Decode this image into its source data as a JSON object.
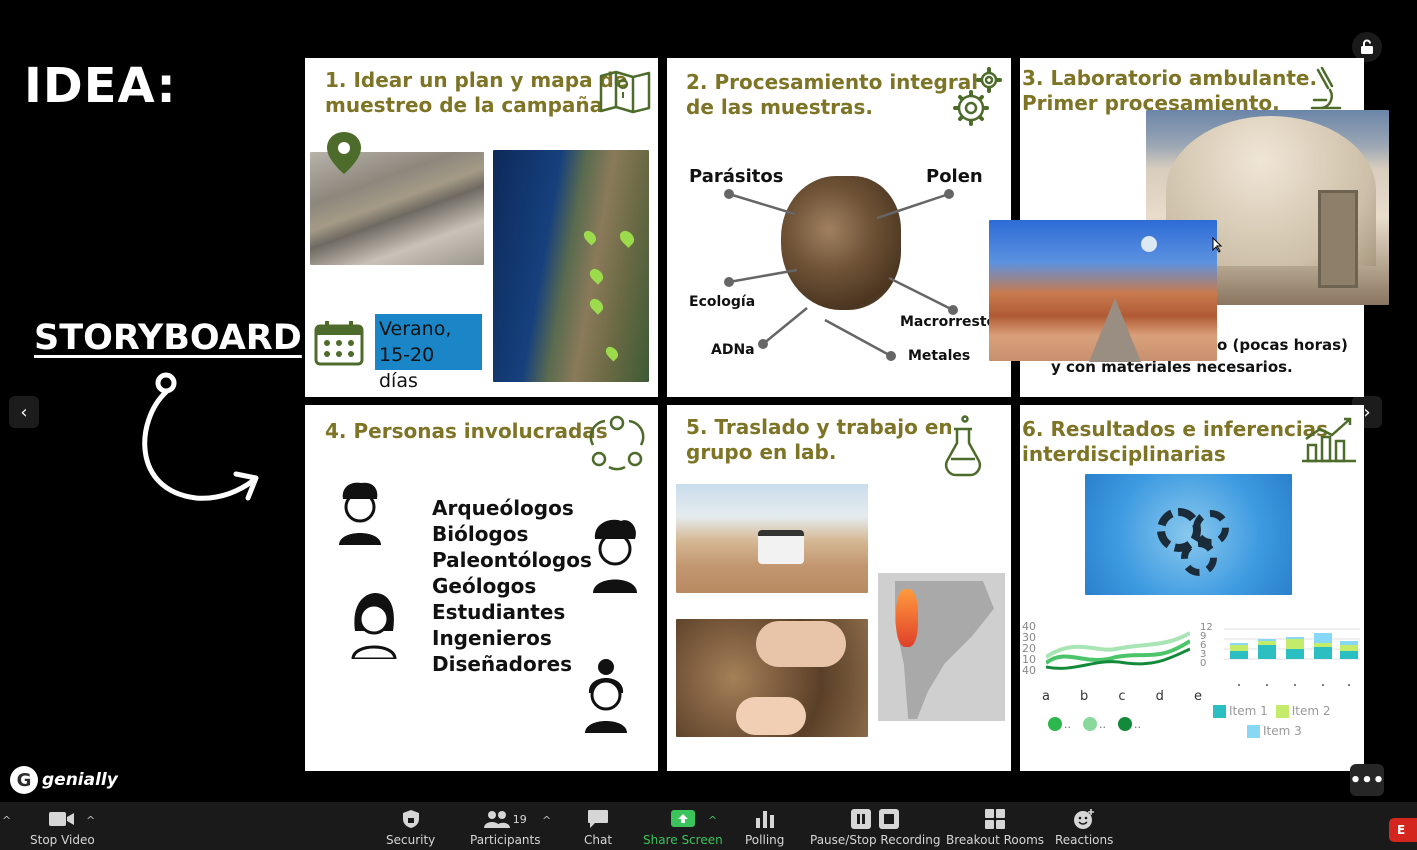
{
  "slide": {
    "idea": "IDEA:",
    "storyboard": "STORYBOARD",
    "logo": "genially",
    "panels": {
      "p1": {
        "title_l1": "1. Idear un plan y mapa de",
        "title_l2": "muestreo de la campaña",
        "badge_l1": "Verano,",
        "badge_l2": "15-20 días"
      },
      "p2": {
        "title_l1": "2. Procesamiento integral",
        "title_l2": "de las muestras.",
        "labels": {
          "parasitos": "Parásitos",
          "polen": "Polen",
          "ecologia": "Ecología",
          "macrorresto": "Macrorresto",
          "adna": "ADNa",
          "metales": "Metales"
        }
      },
      "p3": {
        "title_l1": "3. Laboratorio ambulante.",
        "title_l2": "Primer procesamiento.",
        "body_l1": "o (pocas horas)",
        "body_l2": "y con materiales necesarios."
      },
      "p4": {
        "title": "4. Personas involucradas",
        "roles": [
          "Arqueólogos",
          "Biólogos",
          "Paleontólogos",
          "Geólogos",
          "Estudiantes",
          "Ingenieros",
          "Diseñadores"
        ]
      },
      "p5": {
        "title_l1": "5. Traslado y trabajo en",
        "title_l2": "grupo en lab."
      },
      "p6": {
        "title_l1": "6. Resultados e inferencias",
        "title_l2": "interdisciplinarias",
        "line_chart": {
          "y_ticks": [
            "40",
            "30",
            "20",
            "10",
            "40"
          ],
          "x_ticks": [
            "a",
            "b",
            "c",
            "d",
            "e"
          ],
          "legend": [
            "..",
            "..",
            ".."
          ]
        },
        "bar_chart": {
          "y_ticks": [
            "12",
            "9",
            "6",
            "3",
            "0"
          ],
          "legend": [
            "Item 1",
            "Item 2",
            "Item 3"
          ]
        }
      }
    }
  },
  "toolbar": {
    "stop_video": "Stop Video",
    "security": "Security",
    "participants": "Participants",
    "participants_count": "19",
    "chat": "Chat",
    "share_screen": "Share Screen",
    "polling": "Polling",
    "recording": "Pause/Stop Recording",
    "breakout": "Breakout Rooms",
    "reactions": "Reactions",
    "end": "E"
  },
  "colors": {
    "title_olive": "#7e7426",
    "icon_green": "#4d6b2a",
    "badge_blue": "#1a86c8",
    "share_green": "#3bc35c",
    "end_red": "#d4261f"
  }
}
